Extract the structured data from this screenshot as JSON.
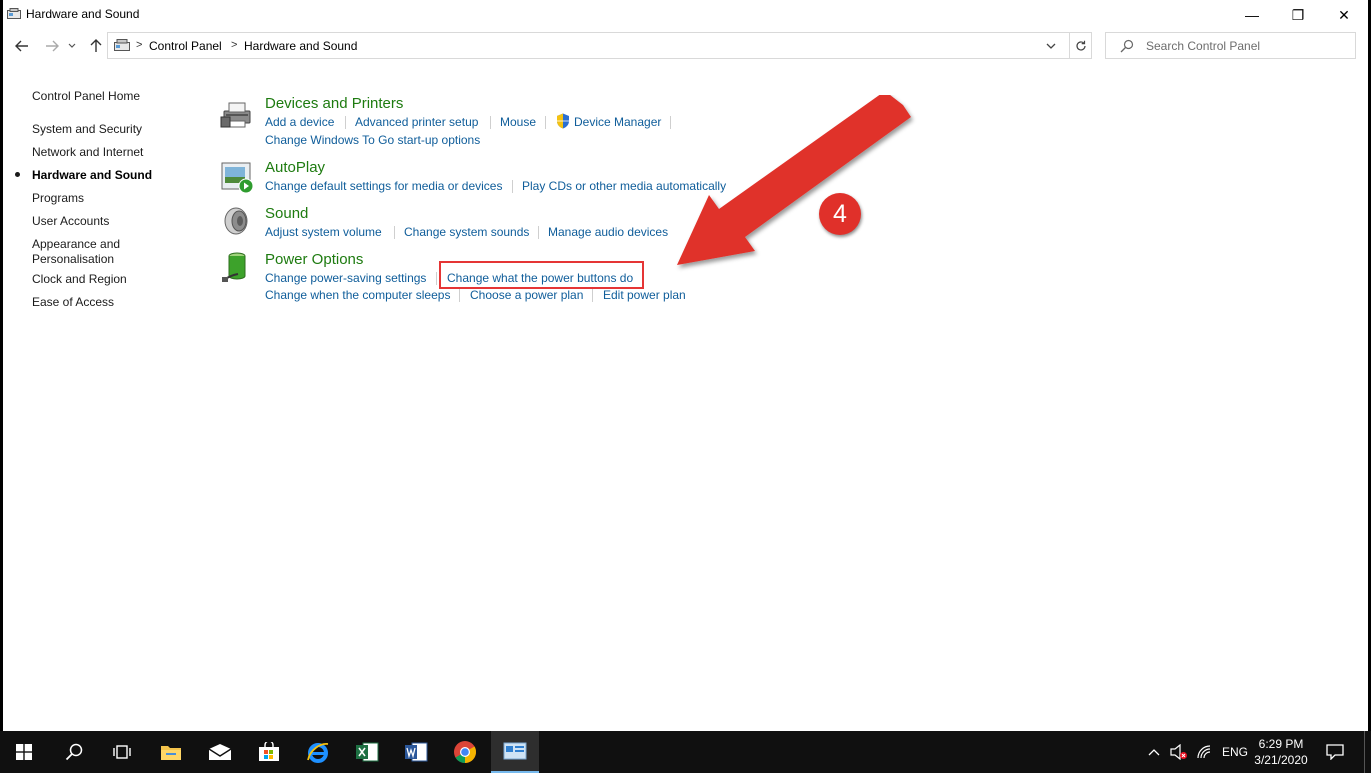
{
  "window": {
    "title": "Hardware and Sound",
    "min_glyph": "—",
    "max_glyph": "❐",
    "close_glyph": "✕"
  },
  "address": {
    "breadcrumbs": [
      "Control Panel",
      "Hardware and Sound"
    ],
    "separator": ">"
  },
  "search": {
    "placeholder": "Search Control Panel"
  },
  "sidebar": {
    "home": "Control Panel Home",
    "items": [
      {
        "label": "System and Security",
        "active": false
      },
      {
        "label": "Network and Internet",
        "active": false
      },
      {
        "label": "Hardware and Sound",
        "active": true
      },
      {
        "label": "Programs",
        "active": false
      },
      {
        "label": "User Accounts",
        "active": false
      },
      {
        "label": "Appearance and",
        "label2": "Personalisation",
        "active": false
      },
      {
        "label": "Clock and Region",
        "active": false
      },
      {
        "label": "Ease of Access",
        "active": false
      }
    ]
  },
  "categories": {
    "devices": {
      "title": "Devices and Printers",
      "icon": "printer-icon",
      "links": [
        "Add a device",
        "Advanced printer setup",
        "Mouse",
        "Device Manager",
        "Change Windows To Go start-up options"
      ]
    },
    "autoplay": {
      "title": "AutoPlay",
      "icon": "autoplay-icon",
      "links": [
        "Change default settings for media or devices",
        "Play CDs or other media automatically"
      ]
    },
    "sound": {
      "title": "Sound",
      "icon": "speaker-icon",
      "links": [
        "Adjust system volume",
        "Change system sounds",
        "Manage audio devices"
      ]
    },
    "power": {
      "title": "Power Options",
      "icon": "battery-icon",
      "links": [
        "Change power-saving settings",
        "Change what the power buttons do",
        "Change when the computer sleeps",
        "Choose a power plan",
        "Edit power plan"
      ]
    }
  },
  "annotation": {
    "step": "4",
    "color": "#e0302a"
  },
  "taskbar": {
    "apps": [
      "start-icon",
      "search-icon",
      "task-view-icon",
      "file-explorer-icon",
      "mail-icon",
      "store-icon",
      "edge-icon",
      "excel-icon",
      "word-icon",
      "chrome-icon",
      "control-panel-icon"
    ],
    "language": "ENG",
    "time": "6:29 PM",
    "date": "3/21/2020"
  }
}
